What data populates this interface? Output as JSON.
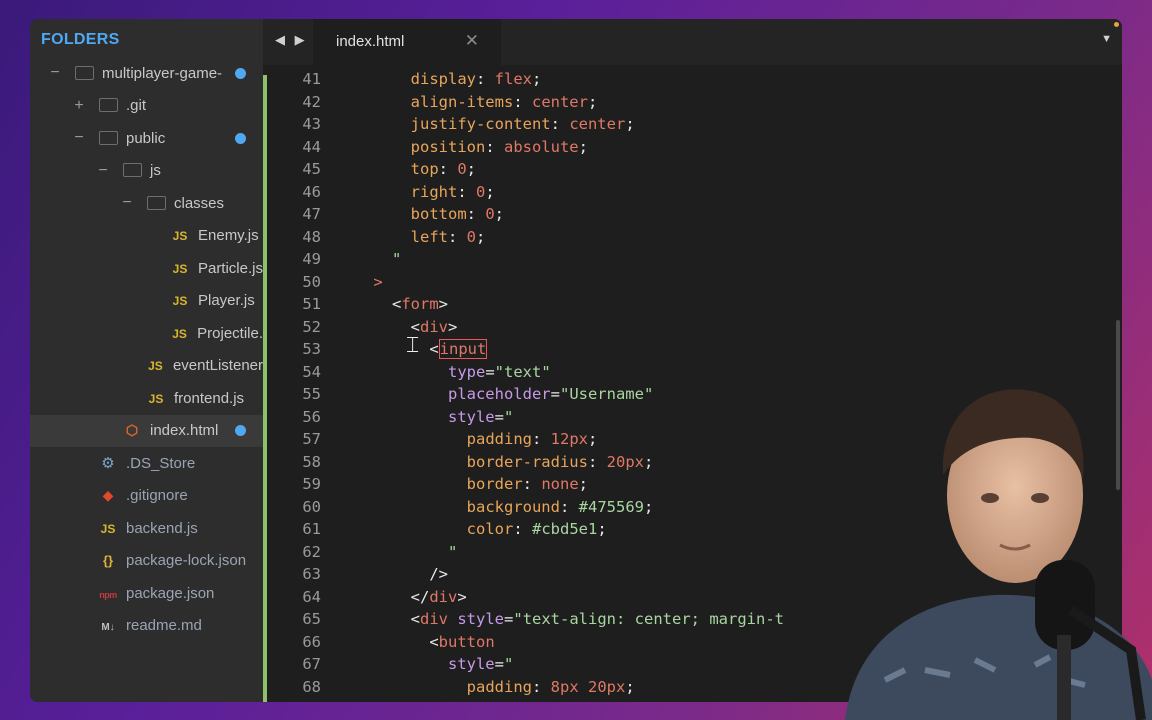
{
  "sidebar": {
    "title": "FOLDERS",
    "items": [
      {
        "name": "multiplayer-game-",
        "type": "folder",
        "indent": 1,
        "toggle": "−",
        "modified": true
      },
      {
        "name": ".git",
        "type": "folder",
        "indent": 2,
        "toggle": "+"
      },
      {
        "name": "public",
        "type": "folder",
        "indent": 2,
        "toggle": "−",
        "modified": true
      },
      {
        "name": "js",
        "type": "folder",
        "indent": 3,
        "toggle": "−"
      },
      {
        "name": "classes",
        "type": "folder",
        "indent": 4,
        "toggle": "−"
      },
      {
        "name": "Enemy.js",
        "type": "js",
        "indent": 5
      },
      {
        "name": "Particle.js",
        "type": "js",
        "indent": 5
      },
      {
        "name": "Player.js",
        "type": "js",
        "indent": 5
      },
      {
        "name": "Projectile.",
        "type": "js",
        "indent": 5
      },
      {
        "name": "eventListener",
        "type": "js",
        "indent": 4
      },
      {
        "name": "frontend.js",
        "type": "js",
        "indent": 4
      },
      {
        "name": "index.html",
        "type": "html",
        "indent": 3,
        "selected": true,
        "modified": true
      },
      {
        "name": ".DS_Store",
        "type": "gear",
        "indent": 2
      },
      {
        "name": ".gitignore",
        "type": "git",
        "indent": 2
      },
      {
        "name": "backend.js",
        "type": "js",
        "indent": 2
      },
      {
        "name": "package-lock.json",
        "type": "json",
        "indent": 2
      },
      {
        "name": "package.json",
        "type": "npm",
        "indent": 2
      },
      {
        "name": "readme.md",
        "type": "md",
        "indent": 2
      }
    ]
  },
  "tabbar": {
    "nav_arrows": "◀ ▶",
    "tab_label": "index.html",
    "close_glyph": "✕",
    "menu_glyph": "▼"
  },
  "editor": {
    "lines": [
      {
        "n": "41",
        "tokens": [
          [
            "sp",
            "        "
          ],
          [
            "kw",
            "display"
          ],
          [
            "pun",
            ": "
          ],
          [
            "val",
            "flex"
          ],
          [
            "pun",
            ";"
          ]
        ]
      },
      {
        "n": "42",
        "tokens": [
          [
            "sp",
            "        "
          ],
          [
            "kw",
            "align-items"
          ],
          [
            "pun",
            ": "
          ],
          [
            "val",
            "center"
          ],
          [
            "pun",
            ";"
          ]
        ]
      },
      {
        "n": "43",
        "tokens": [
          [
            "sp",
            "        "
          ],
          [
            "kw",
            "justify-content"
          ],
          [
            "pun",
            ": "
          ],
          [
            "val",
            "center"
          ],
          [
            "pun",
            ";"
          ]
        ]
      },
      {
        "n": "44",
        "tokens": [
          [
            "sp",
            "        "
          ],
          [
            "kw",
            "position"
          ],
          [
            "pun",
            ": "
          ],
          [
            "val",
            "absolute"
          ],
          [
            "pun",
            ";"
          ]
        ]
      },
      {
        "n": "45",
        "tokens": [
          [
            "sp",
            "        "
          ],
          [
            "kw",
            "top"
          ],
          [
            "pun",
            ": "
          ],
          [
            "val",
            "0"
          ],
          [
            "pun",
            ";"
          ]
        ]
      },
      {
        "n": "46",
        "tokens": [
          [
            "sp",
            "        "
          ],
          [
            "kw",
            "right"
          ],
          [
            "pun",
            ": "
          ],
          [
            "val",
            "0"
          ],
          [
            "pun",
            ";"
          ]
        ]
      },
      {
        "n": "47",
        "tokens": [
          [
            "sp",
            "        "
          ],
          [
            "kw",
            "bottom"
          ],
          [
            "pun",
            ": "
          ],
          [
            "val",
            "0"
          ],
          [
            "pun",
            ";"
          ]
        ]
      },
      {
        "n": "48",
        "tokens": [
          [
            "sp",
            "        "
          ],
          [
            "kw",
            "left"
          ],
          [
            "pun",
            ": "
          ],
          [
            "val",
            "0"
          ],
          [
            "pun",
            ";"
          ]
        ]
      },
      {
        "n": "49",
        "tokens": [
          [
            "sp",
            "      "
          ],
          [
            "str",
            "\""
          ]
        ]
      },
      {
        "n": "50",
        "tokens": [
          [
            "sp",
            "    "
          ],
          [
            "tag",
            ">"
          ]
        ]
      },
      {
        "n": "51",
        "tokens": [
          [
            "sp",
            "      "
          ],
          [
            "pun",
            "<"
          ],
          [
            "tag",
            "form"
          ],
          [
            "pun",
            ">"
          ]
        ]
      },
      {
        "n": "52",
        "tokens": [
          [
            "sp",
            "        "
          ],
          [
            "pun",
            "<"
          ],
          [
            "tag",
            "div"
          ],
          [
            "pun",
            ">"
          ]
        ]
      },
      {
        "n": "53",
        "tokens": [
          [
            "sp",
            "          "
          ],
          [
            "pun",
            "<"
          ],
          [
            "taghl",
            "input"
          ]
        ]
      },
      {
        "n": "54",
        "tokens": [
          [
            "sp",
            "            "
          ],
          [
            "attr",
            "type"
          ],
          [
            "pun",
            "="
          ],
          [
            "str",
            "\"text\""
          ]
        ]
      },
      {
        "n": "55",
        "tokens": [
          [
            "sp",
            "            "
          ],
          [
            "attr",
            "placeholder"
          ],
          [
            "pun",
            "="
          ],
          [
            "str",
            "\"Username\""
          ]
        ]
      },
      {
        "n": "56",
        "tokens": [
          [
            "sp",
            "            "
          ],
          [
            "attr",
            "style"
          ],
          [
            "pun",
            "="
          ],
          [
            "str",
            "\""
          ]
        ]
      },
      {
        "n": "57",
        "tokens": [
          [
            "sp",
            "              "
          ],
          [
            "kw",
            "padding"
          ],
          [
            "pun",
            ": "
          ],
          [
            "val",
            "12px"
          ],
          [
            "pun",
            ";"
          ]
        ]
      },
      {
        "n": "58",
        "tokens": [
          [
            "sp",
            "              "
          ],
          [
            "kw",
            "border-radius"
          ],
          [
            "pun",
            ": "
          ],
          [
            "val",
            "20px"
          ],
          [
            "pun",
            ";"
          ]
        ]
      },
      {
        "n": "59",
        "tokens": [
          [
            "sp",
            "              "
          ],
          [
            "kw",
            "border"
          ],
          [
            "pun",
            ": "
          ],
          [
            "val",
            "none"
          ],
          [
            "pun",
            ";"
          ]
        ]
      },
      {
        "n": "60",
        "tokens": [
          [
            "sp",
            "              "
          ],
          [
            "kw",
            "background"
          ],
          [
            "pun",
            ": "
          ],
          [
            "str",
            "#475569"
          ],
          [
            "pun",
            ";"
          ]
        ]
      },
      {
        "n": "61",
        "tokens": [
          [
            "sp",
            "              "
          ],
          [
            "kw",
            "color"
          ],
          [
            "pun",
            ": "
          ],
          [
            "str",
            "#cbd5e1"
          ],
          [
            "pun",
            ";"
          ]
        ]
      },
      {
        "n": "62",
        "tokens": [
          [
            "sp",
            "            "
          ],
          [
            "str",
            "\""
          ]
        ]
      },
      {
        "n": "63",
        "tokens": [
          [
            "sp",
            "          "
          ],
          [
            "pun",
            "/>"
          ]
        ]
      },
      {
        "n": "64",
        "tokens": [
          [
            "sp",
            "        "
          ],
          [
            "pun",
            "</"
          ],
          [
            "tag",
            "div"
          ],
          [
            "pun",
            ">"
          ]
        ]
      },
      {
        "n": "65",
        "tokens": [
          [
            "sp",
            "        "
          ],
          [
            "pun",
            "<"
          ],
          [
            "tag",
            "div"
          ],
          [
            "pun",
            " "
          ],
          [
            "attr",
            "style"
          ],
          [
            "pun",
            "="
          ],
          [
            "str",
            "\"text-align: center; margin-t"
          ]
        ]
      },
      {
        "n": "66",
        "tokens": [
          [
            "sp",
            "          "
          ],
          [
            "pun",
            "<"
          ],
          [
            "tag",
            "button"
          ]
        ]
      },
      {
        "n": "67",
        "tokens": [
          [
            "sp",
            "            "
          ],
          [
            "attr",
            "style"
          ],
          [
            "pun",
            "="
          ],
          [
            "str",
            "\""
          ]
        ]
      },
      {
        "n": "68",
        "tokens": [
          [
            "sp",
            "              "
          ],
          [
            "kw",
            "padding"
          ],
          [
            "pun",
            ": "
          ],
          [
            "val",
            "8px 20px"
          ],
          [
            "pun",
            ";"
          ]
        ]
      }
    ]
  },
  "colors": {
    "accent": "#4fa8f0",
    "git_modified": "#8dc16b",
    "selected_row": "#3a3a3a"
  }
}
